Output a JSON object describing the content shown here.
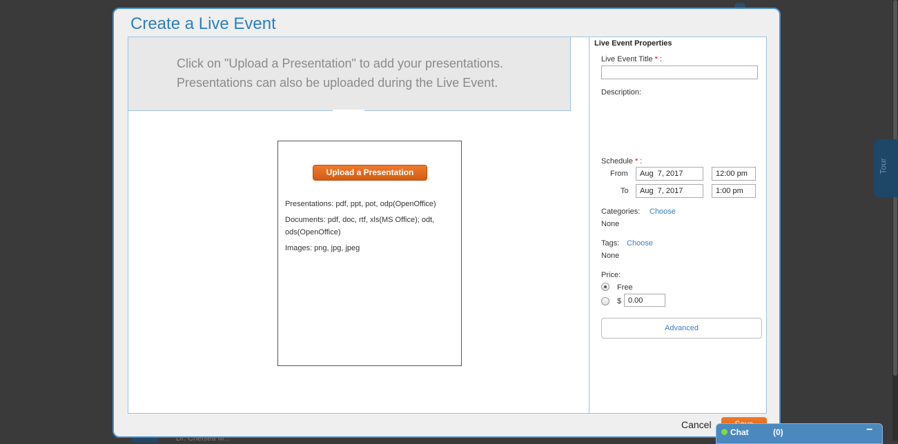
{
  "background": {
    "footer_text": "Dr. Chelsea M..."
  },
  "tour_tab": {
    "label": "Tour"
  },
  "modal": {
    "title": "Create a Live Event",
    "info_line_1": "Click on \"Upload a Presentation\" to add your presentations.",
    "info_line_2": "Presentations can also be uploaded during the Live Event.",
    "upload": {
      "button_label": "Upload a Presentation",
      "formats_presentations": "Presentations: pdf, ppt, pot, odp(OpenOffice)",
      "formats_documents": "Documents: pdf, doc, rtf, xls(MS Office); odt, ods(OpenOffice)",
      "formats_images": "Images: png, jpg, jpeg"
    },
    "properties": {
      "heading": "Live Event Properties",
      "title_label": "Live Event Title",
      "title_value": "",
      "required_mark": "*",
      "colon": ":",
      "description_label": "Description:",
      "schedule_label": "Schedule",
      "from_label": "From",
      "to_label": "To",
      "from_date": "Aug  7, 2017",
      "from_time": "12:00 pm",
      "to_date": "Aug  7, 2017",
      "to_time": "1:00 pm",
      "categories_label": "Categories:",
      "categories_link": "Choose",
      "categories_value": "None",
      "tags_label": "Tags:",
      "tags_link": "Choose",
      "tags_value": "None",
      "price_label": "Price:",
      "price_free_label": "Free",
      "price_currency": "$",
      "price_amount": "0.00",
      "price_selected": "Free",
      "advanced_label": "Advanced"
    },
    "cancel_label": "Cancel",
    "save_label": "Save"
  },
  "chat": {
    "label": "Chat",
    "count": "(0)",
    "minimize": "−",
    "status_color": "#7fdc3c"
  },
  "colors": {
    "accent": "#2c7fc1",
    "button_orange": "#e2691e"
  }
}
